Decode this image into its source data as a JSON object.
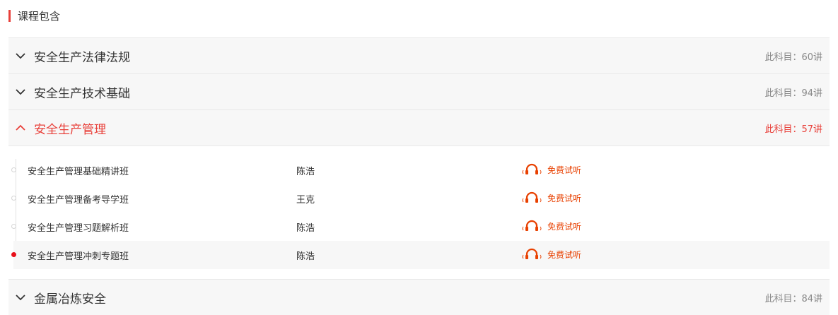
{
  "section": {
    "title": "课程包含"
  },
  "colors": {
    "accent": "#e8403a",
    "active_dot": "#e8101a",
    "trial": "#e84000"
  },
  "accordion": [
    {
      "title": "安全生产法律法规",
      "meta": "此科目：60讲",
      "state": "collapsed"
    },
    {
      "title": "安全生产技术基础",
      "meta": "此科目：94讲",
      "state": "collapsed"
    },
    {
      "title": "安全生产管理",
      "meta": "此科目：57讲",
      "state": "expanded",
      "rows": [
        {
          "name": "安全生产管理基础精讲班",
          "teacher": "陈浩",
          "action": "免费试听",
          "active": false
        },
        {
          "name": "安全生产管理备考导学班",
          "teacher": "王克",
          "action": "免费试听",
          "active": false
        },
        {
          "name": "安全生产管理习题解析班",
          "teacher": "陈浩",
          "action": "免费试听",
          "active": false
        },
        {
          "name": "安全生产管理冲刺专题班",
          "teacher": "陈浩",
          "action": "免费试听",
          "active": true
        }
      ]
    },
    {
      "title": "金属冶炼安全",
      "meta": "此科目：84讲",
      "state": "collapsed"
    }
  ]
}
